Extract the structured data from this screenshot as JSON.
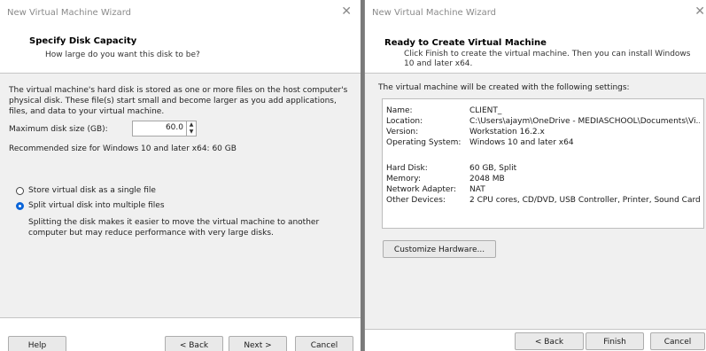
{
  "left_window": {
    "title": "New Virtual Machine Wizard",
    "header_title": "Specify Disk Capacity",
    "header_subtitle": "How large do you want this disk to be?",
    "description": "The virtual machine's hard disk is stored as one or more files on the host computer's physical disk. These file(s) start small and become larger as you add applications, files, and data to your virtual machine.",
    "max_disk_label": "Maximum disk size (GB):",
    "max_disk_value": "60.0",
    "recommended": "Recommended size for Windows 10 and later x64: 60 GB",
    "radio_single_label": "Store virtual disk as a single file",
    "radio_multi_label": "Split virtual disk into multiple files",
    "selected_option": "multi",
    "split_note": "Splitting the disk makes it easier to move the virtual machine to another computer but may reduce performance with very large disks.",
    "buttons": {
      "help": "Help",
      "back": "< Back",
      "next": "Next >",
      "cancel": "Cancel"
    }
  },
  "right_window": {
    "title": "New Virtual Machine Wizard",
    "header_title": "Ready to Create Virtual Machine",
    "header_subtitle": "Click Finish to create the virtual machine. Then you can install Windows 10 and later x64.",
    "intro": "The virtual machine will be created with the following settings:",
    "settings_group1": [
      {
        "key": "Name:",
        "value": "CLIENT_"
      },
      {
        "key": "Location:",
        "value": "C:\\Users\\ajaym\\OneDrive - MEDIASCHOOL\\Documents\\Vi..."
      },
      {
        "key": "Version:",
        "value": "Workstation 16.2.x"
      },
      {
        "key": "Operating System:",
        "value": "Windows 10 and later x64"
      }
    ],
    "settings_group2": [
      {
        "key": "Hard Disk:",
        "value": "60 GB, Split"
      },
      {
        "key": "Memory:",
        "value": "2048 MB"
      },
      {
        "key": "Network Adapter:",
        "value": "NAT"
      },
      {
        "key": "Other Devices:",
        "value": "2 CPU cores, CD/DVD, USB Controller, Printer, Sound Card"
      }
    ],
    "customize_button": "Customize Hardware...",
    "buttons": {
      "back": "< Back",
      "finish": "Finish",
      "cancel": "Cancel"
    }
  },
  "colors": {
    "accent": "#0a64d8",
    "panel": "#f0f0f0",
    "title_text": "#8a8a8a"
  },
  "icons": {
    "close": "close-icon",
    "spin_up": "spin-up-icon",
    "spin_down": "spin-down-icon"
  }
}
